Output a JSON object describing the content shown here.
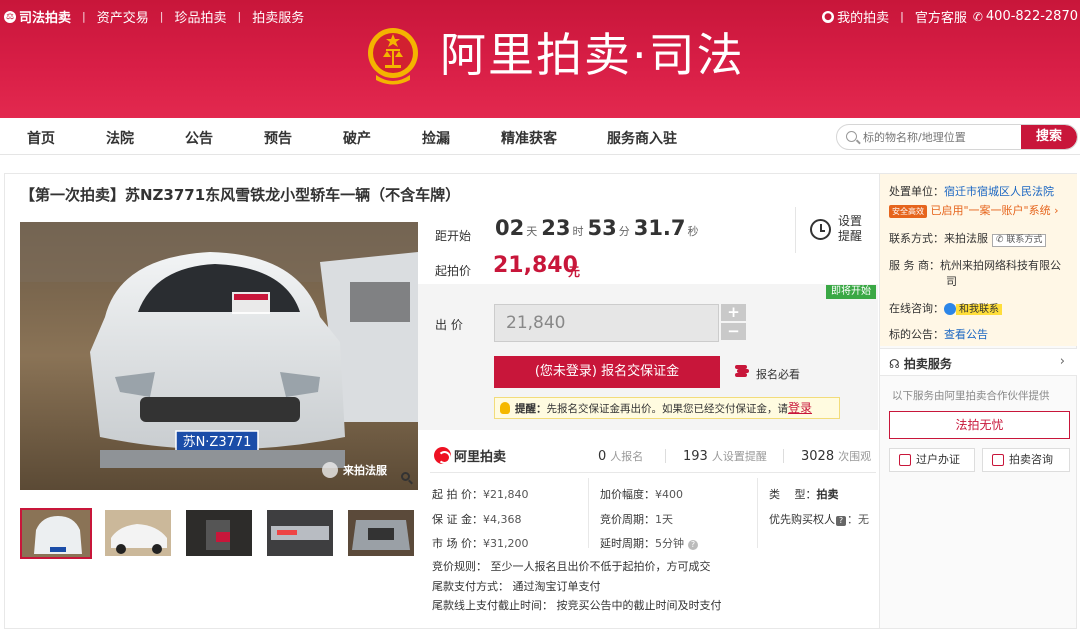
{
  "header": {
    "brand": "司法拍卖",
    "links": [
      "资产交易",
      "珍品拍卖",
      "拍卖服务"
    ],
    "my_auction": "我的拍卖",
    "customer_service": "官方客服",
    "phone": "400-822-2870",
    "logo_title": "阿里拍卖·司法"
  },
  "nav": {
    "items": [
      "首页",
      "法院",
      "公告",
      "预告",
      "破产",
      "捡漏",
      "精准获客",
      "服务商入驻"
    ],
    "search_placeholder": "标的物名称/地理位置",
    "search_button": "搜索"
  },
  "product": {
    "title": "【第一次拍卖】苏NZ3771东风雪铁龙小型轿车一辆（不含车牌）",
    "plate_text": "苏N·Z3771",
    "watermark": "来拍法服"
  },
  "countdown": {
    "label": "距开始",
    "days": "02",
    "day_unit": "天",
    "hours": "23",
    "hour_unit": "时",
    "minutes": "53",
    "minute_unit": "分",
    "seconds": "31.7",
    "second_unit": "秒",
    "remind_label": "设置提醒"
  },
  "start_price": {
    "label": "起拍价",
    "value": "21,840",
    "unit": "元"
  },
  "bid": {
    "status_tag": "即将开始",
    "label": "出 价",
    "value": "21,840",
    "plus": "+",
    "minus": "−",
    "register_button": "(您未登录) 报名交保证金",
    "must_read": "报名必看",
    "tip_prefix": "提醒：",
    "tip_text": "先报名交保证金再出价。如果您已经交付保证金，请",
    "tip_login": "登录"
  },
  "stats": {
    "logo_text": "阿里拍卖",
    "registered_count": "0",
    "registered_unit": "人报名",
    "reminders_count": "193",
    "reminders_unit": "人设置提醒",
    "views_count": "3028",
    "views_unit": "次围观"
  },
  "details": {
    "start_price": {
      "label": "起 拍 价：",
      "value": "¥21,840"
    },
    "deposit": {
      "label": "保 证 金：",
      "value": "¥4,368"
    },
    "market_price": {
      "label": "市 场 价：",
      "value": "¥31,200"
    },
    "increment": {
      "label": "加价幅度：",
      "value": "¥400"
    },
    "bid_cycle": {
      "label": "竞价周期：",
      "value": "1天"
    },
    "delay_cycle": {
      "label": "延时周期：",
      "value": "5分钟"
    },
    "type": {
      "label": "类　 型：",
      "value": "拍卖"
    },
    "priority": {
      "label": "优先购买权人",
      "value": "：无"
    },
    "rules": [
      "竞价规则：   至少一人报名且出价不低于起拍价，方可成交",
      "尾款支付方式：   通过淘宝订单支付",
      "尾款线上支付截止时间：   按竞买公告中的截止时间及时支付"
    ]
  },
  "side": {
    "org_label": "处置单位：",
    "org_value": "宿迁市宿城区人民法院",
    "safe_badge": "安全高效",
    "account_text": "已启用\"一案一账户\"系统",
    "contact_label": "联系方式：",
    "contact_value": "来拍法服",
    "contact_tag": "联系方式",
    "provider_label": "服 务 商：",
    "provider_value": "杭州来拍网络科技有限公",
    "provider_value2": "司",
    "online_label": "在线咨询：",
    "online_value": "和我联系",
    "notice_label": "标的公告：",
    "notice_value": "查看公告",
    "service_title": "拍卖服务",
    "service_arrow": "›",
    "service_note": "以下服务由阿里拍卖合作伙伴提供",
    "legal_button": "法拍无忧",
    "transfer_button": "过户办证",
    "consult_button": "拍卖咨询"
  },
  "colors": {
    "brand_red": "#c8163a",
    "status_green": "#3aa845",
    "link_blue": "#1a66c2",
    "accent_orange": "#e6651d"
  }
}
